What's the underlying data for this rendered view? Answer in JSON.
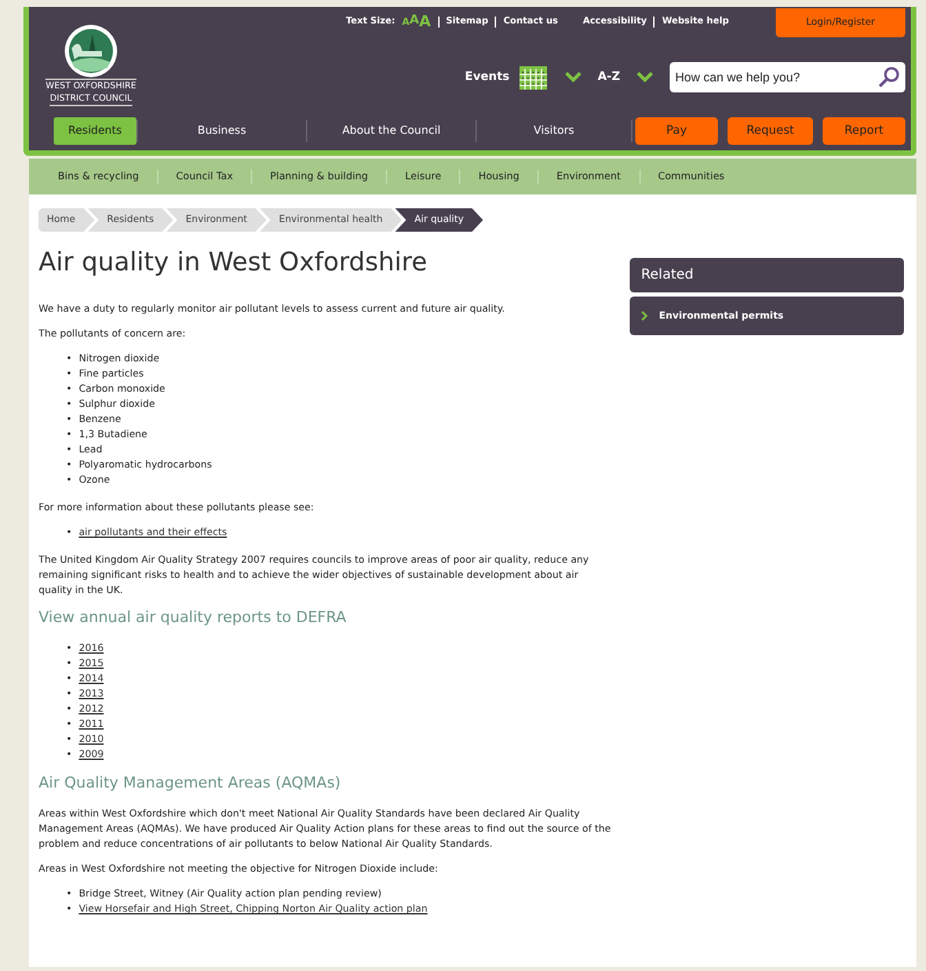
{
  "header": {
    "logo": {
      "line_1": "WEST OXFORDSHIRE",
      "line_2": "DISTRICT COUNCIL"
    },
    "text_size": {
      "label": "Text Size:",
      "options": [
        "A",
        "A",
        "A"
      ]
    },
    "top_links": [
      "Sitemap",
      "Contact us",
      "Accessibility",
      "Website help"
    ],
    "login": "Login/Register",
    "events": "Events",
    "az": "A-Z",
    "search": {
      "placeholder": "How can we help you?"
    },
    "main_nav": [
      {
        "label": "Residents",
        "selected": true
      },
      {
        "label": "Business",
        "selected": false
      },
      {
        "label": "About the Council",
        "selected": false
      },
      {
        "label": "Visitors",
        "selected": false
      }
    ],
    "action_buttons": [
      "Pay",
      "Request",
      "Report"
    ]
  },
  "sub_nav": [
    "Bins & recycling",
    "Council Tax",
    "Planning & building",
    "Leisure",
    "Housing",
    "Environment",
    "Communities"
  ],
  "breadcrumb": [
    {
      "label": "Home",
      "selected": false
    },
    {
      "label": "Residents",
      "selected": false
    },
    {
      "label": "Environment",
      "selected": false
    },
    {
      "label": "Environmental health",
      "selected": false
    },
    {
      "label": "Air quality",
      "selected": true
    }
  ],
  "title": "Air quality in West Oxfordshire",
  "blocks": [
    {
      "kind": "paragraph",
      "text": "We have a duty to regularly monitor air pollutant levels to assess current and future air quality."
    },
    {
      "kind": "paragraph",
      "text": "The pollutants of concern are:"
    },
    {
      "kind": "list",
      "marker": "•",
      "items": [
        {
          "text": "Nitrogen dioxide",
          "link": false
        },
        {
          "text": "Fine particles",
          "link": false
        },
        {
          "text": "Carbon monoxide",
          "link": false
        },
        {
          "text": "Sulphur dioxide",
          "link": false
        },
        {
          "text": "Benzene",
          "link": false
        },
        {
          "text": "1,3 Butadiene",
          "link": false
        },
        {
          "text": "Lead",
          "link": false
        },
        {
          "text": "Polyaromatic hydrocarbons",
          "link": false
        },
        {
          "text": "Ozone",
          "link": false
        }
      ]
    },
    {
      "kind": "paragraph",
      "text": "For more information about these pollutants please see:"
    },
    {
      "kind": "list",
      "marker": "•",
      "items": [
        {
          "text": "air pollutants and their effects",
          "link": true
        }
      ]
    },
    {
      "kind": "paragraph",
      "text": "The United Kingdom Air Quality Strategy 2007 requires councils to improve areas of poor air quality, reduce any remaining significant risks to health and to achieve the wider objectives of sustainable development about air quality in the UK."
    },
    {
      "kind": "heading",
      "text": "View annual air quality reports to DEFRA"
    },
    {
      "kind": "list",
      "marker": "•",
      "items": [
        {
          "text": "2016",
          "link": true
        },
        {
          "text": "2015",
          "link": true
        },
        {
          "text": "2014",
          "link": true
        },
        {
          "text": "2013",
          "link": true
        },
        {
          "text": "2012",
          "link": true
        },
        {
          "text": "2011",
          "link": true
        },
        {
          "text": "2010",
          "link": true
        },
        {
          "text": "2009",
          "link": true
        }
      ]
    },
    {
      "kind": "heading",
      "text": "Air Quality Management Areas (AQMAs)"
    },
    {
      "kind": "paragraph",
      "text": "Areas within West Oxfordshire which don't meet National Air Quality Standards have been declared Air Quality Management Areas (AQMAs). We have produced Air Quality Action plans for these areas to find out the source of the problem and reduce concentrations of air pollutants to below National Air Quality Standards."
    },
    {
      "kind": "paragraph",
      "text": "Areas in West Oxfordshire not meeting the objective for Nitrogen Dioxide include:"
    },
    {
      "kind": "list",
      "marker": "•",
      "items": [
        {
          "text": "Bridge Street, Witney (Air Quality action plan pending review)",
          "link": false
        },
        {
          "text": "View Horsefair and High Street, Chipping Norton Air Quality action plan",
          "link": true
        }
      ]
    }
  ],
  "related": {
    "title": "Related",
    "items": [
      "Environmental permits"
    ]
  }
}
